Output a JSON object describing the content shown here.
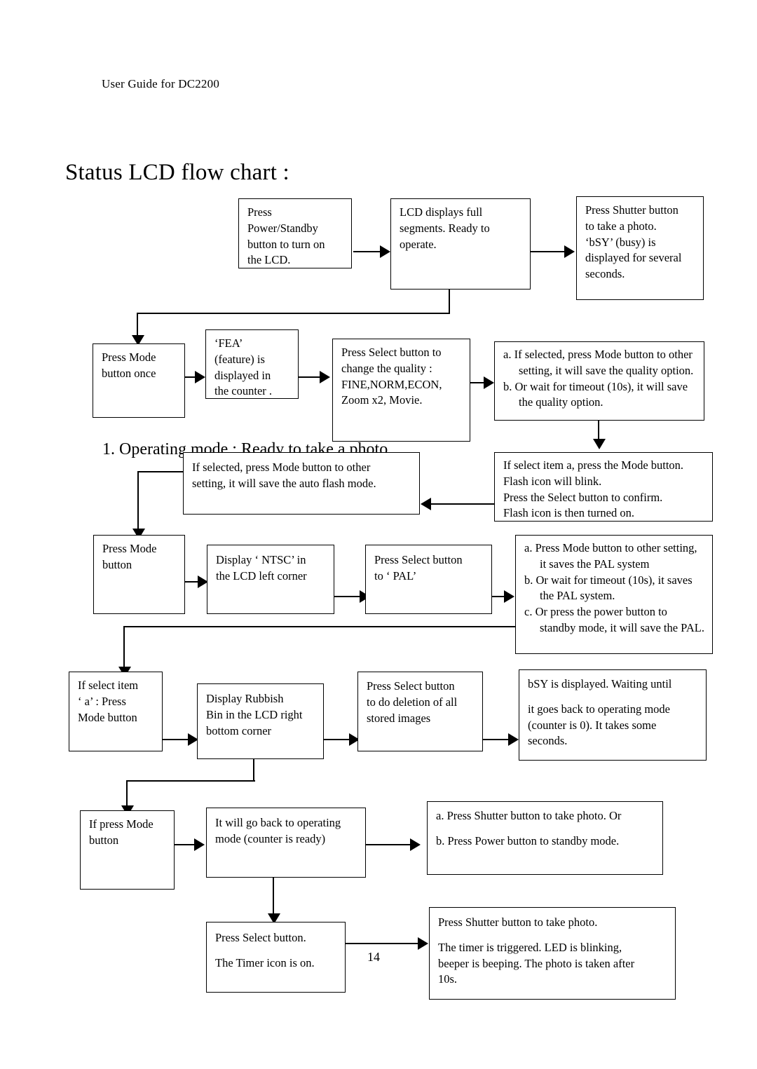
{
  "document": {
    "header": "User Guide for DC2200",
    "title": "Status LCD flow chart :",
    "section_note": "1. Operating mode : Ready to take a photo.",
    "page_number": "14"
  },
  "flowchart": {
    "nodes": {
      "power_standby": {
        "lines": [
          "Press",
          "Power/Standby",
          "button to turn on",
          "the LCD."
        ]
      },
      "lcd_full_segments": {
        "lines": [
          "LCD displays full",
          "segments. Ready to",
          "operate."
        ]
      },
      "shutter_busy": {
        "lines": [
          "Press Shutter button",
          "to  take a photo.",
          "‘bSY’ (busy) is",
          "displayed for several",
          "seconds."
        ]
      },
      "press_mode_once": {
        "lines": [
          "Press Mode",
          "button once"
        ]
      },
      "fea_counter": {
        "lines": [
          "‘FEA’",
          "(feature) is",
          "displayed in",
          "the counter ."
        ]
      },
      "select_quality": {
        "lines": [
          "Press Select button to",
          "change the quality :",
          "FINE,NORM,ECON,",
          "Zoom x2, Movie."
        ]
      },
      "quality_options": {
        "items": [
          "a. If selected, press Mode button to other setting, it will save the quality option.",
          "b. Or wait for timeout (10s), it will save the quality option."
        ]
      },
      "auto_flash_save": {
        "lines": [
          "If selected, press Mode button to other",
          "setting, it will save the auto flash mode."
        ]
      },
      "flash_confirm": {
        "lines": [
          "If select item a, press the Mode button.",
          "Flash icon will blink.",
          "Press the Select button to confirm.",
          "Flash icon is then turned on."
        ]
      },
      "press_mode_button": {
        "lines": [
          "Press Mode",
          "button"
        ]
      },
      "display_ntsc": {
        "lines": [
          "Display ‘ NTSC’  in",
          "the LCD left corner"
        ]
      },
      "select_pal": {
        "lines": [
          "Press Select button",
          "to ‘ PAL’"
        ]
      },
      "pal_options": {
        "items": [
          "a. Press Mode button to other setting, it saves the PAL system",
          "b. Or wait for timeout (10s), it saves the PAL system.",
          "c.  Or press the power button to standby mode, it will  save the PAL."
        ]
      },
      "select_item_a": {
        "lines": [
          "If select item",
          "‘ a’ : Press",
          "Mode button"
        ]
      },
      "rubbish_bin": {
        "lines": [
          "Display Rubbish",
          "Bin in the LCD right",
          "bottom corner"
        ]
      },
      "delete_all": {
        "lines": [
          "Press Select button",
          "to do deletion of all",
          "stored images"
        ]
      },
      "bsy_wait": {
        "first": "bSY is displayed. Waiting until",
        "rest": [
          "it goes back to operating mode",
          "(counter is 0). It takes some",
          "seconds."
        ]
      },
      "if_press_mode": {
        "lines": [
          "If press Mode",
          "button"
        ]
      },
      "back_to_operating": {
        "lines": [
          "It will go back to operating",
          "mode (counter is ready)"
        ]
      },
      "shutter_or_power": {
        "items": [
          "a. Press Shutter button to take photo. Or",
          "b. Press Power button to standby mode."
        ]
      },
      "timer_on": {
        "first": "Press Select button.",
        "second": "The Timer icon is on."
      },
      "timer_triggered": {
        "first": "Press Shutter button to take photo.",
        "rest": [
          "The timer is triggered. LED is blinking,",
          "beeper is beeping. The photo is taken after",
          "10s."
        ]
      }
    }
  },
  "colors": {
    "ink": "#000000",
    "paper": "#ffffff"
  }
}
